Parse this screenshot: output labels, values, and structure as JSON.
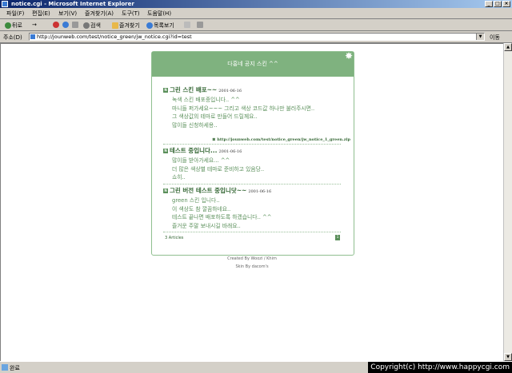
{
  "window": {
    "title": "notice.cgi - Microsoft Internet Explorer",
    "min": "_",
    "max": "□",
    "close": "×"
  },
  "menu": [
    "파일(F)",
    "편집(E)",
    "보기(V)",
    "즐겨찾기(A)",
    "도구(T)",
    "도움말(H)"
  ],
  "toolbar": {
    "back": "뒤로",
    "forward": "→",
    "search": "검색",
    "favorites": "즐겨찾기",
    "history": "목록보기"
  },
  "address": {
    "label": "주소(D)",
    "url": "http://jounweb.com/test/notice_green/jw_notice.cgi?id=test",
    "go": "이동"
  },
  "board": {
    "header": "다홍네 공지 스킨 ^^",
    "posts": [
      {
        "bullet": "N",
        "title": "그린 스킨 배포~~",
        "date": "2001-06-16",
        "lines": [
          "녹색 스킨 배포중입니다.. ^^",
          "마니들 퍼가세요~~~ 그리고 색상 코드값 하나만 불러주시면..",
          "그 색상값의 테마로 만들어 드릴께요..",
          "많이들 신청하세용.."
        ],
        "link": "http://jounweb.com/test/notice_green/jw_notice_1_green.zip"
      },
      {
        "bullet": "N",
        "title": "테스트 중입니다...",
        "date": "2001-06-16",
        "lines": [
          "많이들 받아가세요... ^^",
          "더 많은 색상별 테마로 준비하고 있음당..",
          "쇼히.."
        ],
        "link": ""
      },
      {
        "bullet": "N",
        "title": "그린 버전 테스트 중입니닷~~",
        "date": "2001-06-16",
        "lines": [
          "green 스킨 입니다..",
          "이 색상도 참 깔끔하네요..",
          "테스트 끝나면 배포하도록 하겠습니다.. ^^",
          "즐거운 주말 보내시길 바래요.."
        ],
        "link": ""
      }
    ],
    "articles": "3 Articles",
    "page": "1"
  },
  "credits": {
    "line1": "Created By Woozi / Khim",
    "line2": "Skin By dacom's"
  },
  "status": {
    "text": "완료",
    "copyright": "Copyright(c) http://www.happycgi.com"
  }
}
